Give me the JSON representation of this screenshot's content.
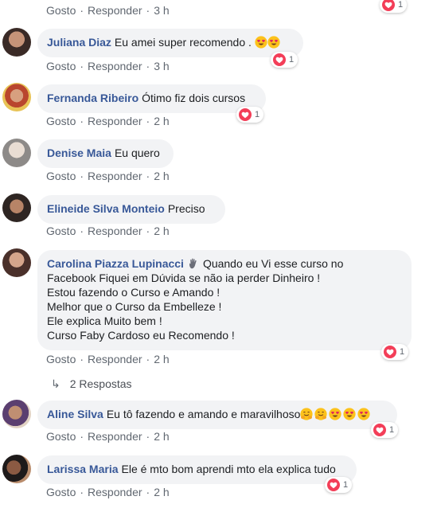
{
  "comments": [
    {
      "author": "",
      "text": "",
      "actions": {
        "like": "Gosto",
        "reply": "Responder",
        "time": "3 h"
      },
      "reactions": "1"
    },
    {
      "author": "Juliana Diaz",
      "text": "Eu amei super recomendo .",
      "actions": {
        "like": "Gosto",
        "reply": "Responder",
        "time": "3 h"
      },
      "reactions": "1"
    },
    {
      "author": "Fernanda Ribeiro",
      "text": "Ótimo fiz dois cursos",
      "actions": {
        "like": "Gosto",
        "reply": "Responder",
        "time": "2 h"
      },
      "reactions": "1"
    },
    {
      "author": "Denise Maia",
      "text": "Eu quero",
      "actions": {
        "like": "Gosto",
        "reply": "Responder",
        "time": "2 h"
      }
    },
    {
      "author": "Elineide Silva Monteio",
      "text": "Preciso",
      "actions": {
        "like": "Gosto",
        "reply": "Responder",
        "time": "2 h"
      }
    },
    {
      "author": "Carolina Piazza Lupinacci",
      "lines": [
        "Quando eu Vi esse curso no",
        "Facebook Fiquei em Dúvida se não ia perder Dinheiro !",
        "Estou fazendo o Curso e Amando !",
        "Melhor que o Curso da Embelleze !",
        "Ele explica Muito bem !",
        "Curso Faby Cardoso eu Recomendo !"
      ],
      "actions": {
        "like": "Gosto",
        "reply": "Responder",
        "time": "2 h"
      },
      "reactions": "1",
      "replies_label": "2 Respostas"
    },
    {
      "author": "Aline Silva",
      "text": "Eu tô fazendo e amando e maravilhoso",
      "actions": {
        "like": "Gosto",
        "reply": "Responder",
        "time": "2 h"
      },
      "reactions": "1"
    },
    {
      "author": "Larissa Maria",
      "text": "Ele é mto bom aprendi mto ela explica tudo",
      "actions": {
        "like": "Gosto",
        "reply": "Responder",
        "time": "2 h"
      },
      "reactions": "1"
    }
  ],
  "colors": {
    "author": "#385898",
    "bubble": "#f2f3f5",
    "love": "#f33e58",
    "meta": "#606770"
  }
}
